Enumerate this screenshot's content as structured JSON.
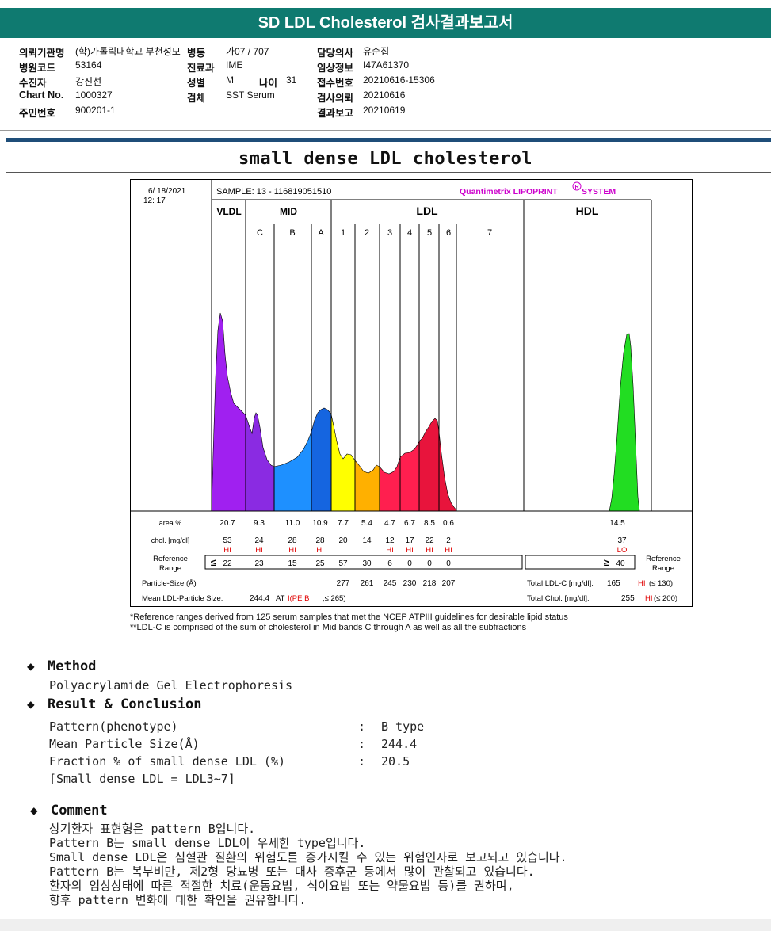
{
  "header": {
    "title": "SD LDL Cholesterol 검사결과보고서"
  },
  "patient_info": {
    "rows": [
      [
        {
          "label": "의뢰기관명",
          "value": "(학)가톨릭대학교 부천성모"
        },
        {
          "label": "병동",
          "value": "가07 / 707"
        },
        {
          "label": "담당의사",
          "value": "유순집"
        }
      ],
      [
        {
          "label": "병원코드",
          "value": "53164"
        },
        {
          "label": "진료과",
          "value": "IME"
        },
        {
          "label": "임상정보",
          "value": "I47A61370"
        }
      ],
      [
        {
          "label": "수진자",
          "value": "강진선"
        },
        {
          "label": "성별",
          "value": "M"
        },
        {
          "label": "나이",
          "value": "31"
        },
        {
          "label": "접수번호",
          "value": "20210616-15306"
        }
      ],
      [
        {
          "label": "Chart No.",
          "value": "1000327"
        },
        {
          "label": "검체",
          "value": "SST Serum"
        },
        {
          "label": "검사의뢰",
          "value": "20210616"
        }
      ],
      [
        {
          "label": "주민번호",
          "value": "900201-1"
        },
        {
          "label": "결과보고",
          "value": "20210619"
        }
      ]
    ]
  },
  "report": {
    "title": "small dense LDL cholesterol"
  },
  "lipoprint": {
    "date": "6/ 18/2021",
    "time": "12: 17",
    "sample": "SAMPLE:    13 - 116819051510",
    "brand": "Quantimetrix LIPOPRINT",
    "brand_suffix": "SYSTEM",
    "brand_mark": "R",
    "groups": [
      "VLDL",
      "MID",
      "LDL",
      "HDL"
    ],
    "bands": [
      "C",
      "B",
      "A",
      "1",
      "2",
      "3",
      "4",
      "5",
      "6",
      "7"
    ],
    "colors": {
      "vldl": "#a020f0",
      "c": "#8a2be2",
      "b": "#1e90ff",
      "a": "#1565e0",
      "ldl1": "#ffff00",
      "ldl2": "#ffb000",
      "ldl3": "#ff1f4f",
      "ldl4": "#ff1f4f",
      "ldl5": "#e8143c",
      "ldl6": "#e8143c",
      "hdl": "#22dd22"
    },
    "table": {
      "area_label": "area %",
      "area": [
        "20.7",
        "9.3",
        "11.0",
        "10.9",
        "7.7",
        "5.4",
        "4.7",
        "6.7",
        "8.5",
        "0.6"
      ],
      "hdl_area": "14.5",
      "chol_label": "chol. [mg/dl]",
      "chol": [
        "53",
        "24",
        "28",
        "28",
        "20",
        "14",
        "12",
        "17",
        "22",
        "2"
      ],
      "hdl_chol": "37",
      "flags": [
        "HI",
        "HI",
        "HI",
        "HI",
        "",
        "",
        "HI",
        "HI",
        "HI",
        "HI"
      ],
      "hdl_flag": "LO",
      "ref_label_1": "Reference",
      "ref_label_2": "Range",
      "ref_sym": "≤",
      "ref": [
        "22",
        "23",
        "15",
        "25",
        "57",
        "30",
        "6",
        "0",
        "0",
        "0"
      ],
      "hdl_ref_sym": "≥",
      "hdl_ref": "40",
      "size_label": "Particle-Size (Å)",
      "sizes": [
        "277",
        "261",
        "245",
        "230",
        "218",
        "207"
      ],
      "mean_label": "Mean LDL-Particle Size:",
      "mean_value": "244.4",
      "mean_type_prefix": "AT",
      "mean_type": "I(PE B",
      "mean_limit": ";≤ 265)",
      "total_ldl_label": "Total LDL-C [mg/dl]:",
      "total_ldl": "165",
      "total_ldl_flag": "HI",
      "total_ldl_limit": "(≤ 130)",
      "total_chol_label": "Total Chol. [mg/dl]:",
      "total_chol": "255",
      "total_chol_flag": "HI",
      "total_chol_limit": "(≤ 200)"
    },
    "footnotes": [
      "*Reference ranges derived from 125 serum samples that met the NCEP ATPIII guidelines for desirable lipid status",
      "**LDL-C is comprised of the sum of cholesterol in Mid bands C through A as well as all the subfractions"
    ]
  },
  "method": {
    "heading": "Method",
    "text": "Polyacrylamide Gel Electrophoresis"
  },
  "result": {
    "heading": "Result & Conclusion",
    "items": [
      {
        "label": "Pattern(phenotype)",
        "value": "B type"
      },
      {
        "label": "Mean Particle Size(Å)",
        "value": "244.4"
      },
      {
        "label": "Fraction % of small dense LDL (%)",
        "value": "20.5"
      }
    ],
    "note": "[Small dense LDL = LDL3~7]"
  },
  "comment": {
    "heading": "Comment",
    "lines": [
      "상기환자 표현형은 pattern B입니다.",
      "Pattern B는 small dense LDL이 우세한 type입니다.",
      "Small dense LDL은 심혈관 질환의 위험도를 증가시킬 수 있는 위험인자로 보고되고 있습니다.",
      "Pattern B는 복부비만, 제2형 당뇨병 또는 대사 증후군 등에서 많이 관찰되고 있습니다.",
      "환자의 임상상태에 따른 적절한 치료(운동요법, 식이요법 또는 약물요법 등)를 권하며,",
      "향후 pattern 변화에 대한 확인을 권유합니다."
    ]
  }
}
